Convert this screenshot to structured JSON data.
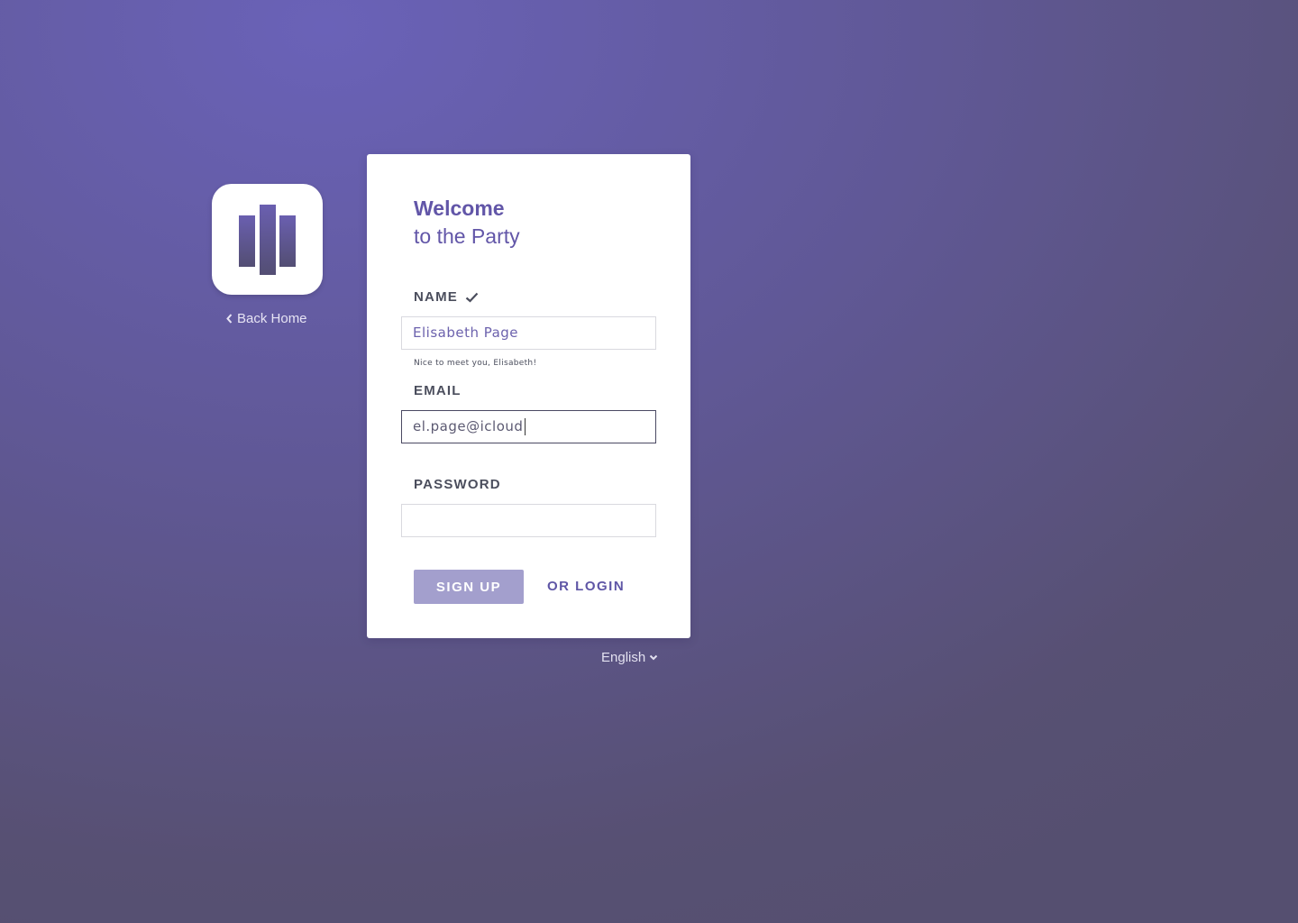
{
  "app": {
    "icon": "bars-logo-icon",
    "back_label": "Back Home"
  },
  "card": {
    "title_line1": "Welcome",
    "title_line2": "to the Party"
  },
  "form": {
    "name": {
      "label": "NAME",
      "value": "Elisabeth Page",
      "status_icon": "check-icon",
      "hint": "Nice to meet you, Elisabeth!"
    },
    "email": {
      "label": "EMAIL",
      "value": "el.page@icloud"
    },
    "password": {
      "label": "PASSWORD",
      "value": ""
    },
    "signup_label": "SIGN UP",
    "login_label": "OR LOGIN"
  },
  "language": {
    "selected": "English"
  },
  "colors": {
    "accent": "#6256a8",
    "button_bg": "#a39fcd",
    "background": "#605896"
  }
}
